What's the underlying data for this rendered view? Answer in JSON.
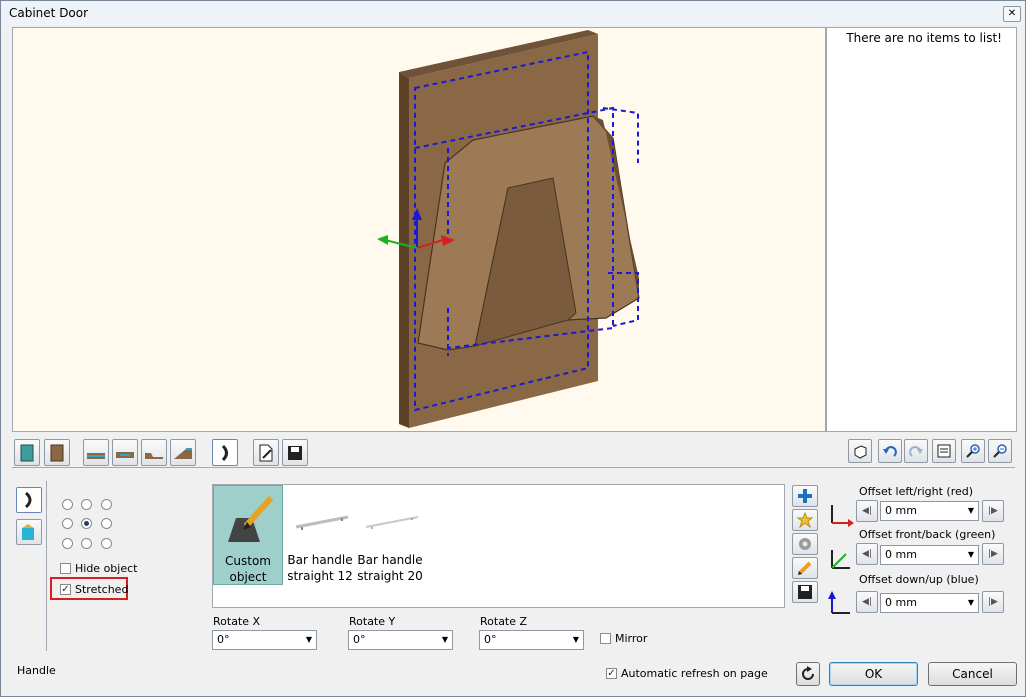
{
  "window": {
    "title": "Cabinet Door",
    "close_glyph": "✕"
  },
  "list_panel": {
    "empty_text": "There are no items to list!"
  },
  "toolbar_left": [
    "door-front-icon",
    "door-side-icon",
    "profile-1-icon",
    "profile-2-icon",
    "profile-3-icon",
    "profile-4-icon",
    "handle-icon",
    "edit-icon",
    "save-icon"
  ],
  "toolbar_right": [
    "3d-view-icon",
    "undo-icon",
    "redo-icon",
    "properties-icon",
    "zoom-in-icon",
    "zoom-out-icon"
  ],
  "options": {
    "hide_object": {
      "label": "Hide object",
      "checked": false
    },
    "stretched": {
      "label": "Stretched",
      "checked": true
    },
    "anchor_selected": "center"
  },
  "catalog": {
    "items": [
      {
        "line1": "Custom",
        "line2": "object"
      },
      {
        "line1": "Bar handle",
        "line2": "straight 12"
      },
      {
        "line1": "Bar handle",
        "line2": "straight 20"
      }
    ]
  },
  "side_buttons": [
    "add-icon",
    "favorite-icon",
    "settings-icon",
    "pencil-icon",
    "save-icon"
  ],
  "rotate": {
    "x": {
      "label": "Rotate X",
      "value": "0°"
    },
    "y": {
      "label": "Rotate Y",
      "value": "0°"
    },
    "z": {
      "label": "Rotate Z",
      "value": "0°"
    },
    "mirror": {
      "label": "Mirror",
      "checked": false
    }
  },
  "offsets": {
    "left_right": {
      "label": "Offset left/right (red)",
      "value": "0 mm"
    },
    "front_back": {
      "label": "Offset front/back (green)",
      "value": "0 mm"
    },
    "down_up": {
      "label": "Offset down/up (blue)",
      "value": "0 mm"
    }
  },
  "footer": {
    "section_label": "Handle",
    "auto_refresh": {
      "label": "Automatic refresh on page",
      "checked": true
    },
    "ok": "OK",
    "cancel": "Cancel"
  },
  "colors": {
    "door": "#8a6846",
    "guide": "#1a1ad6",
    "viewport_bg": "#fff9ee",
    "selected_item": "#9fcfcb",
    "highlight": "#d62020"
  }
}
